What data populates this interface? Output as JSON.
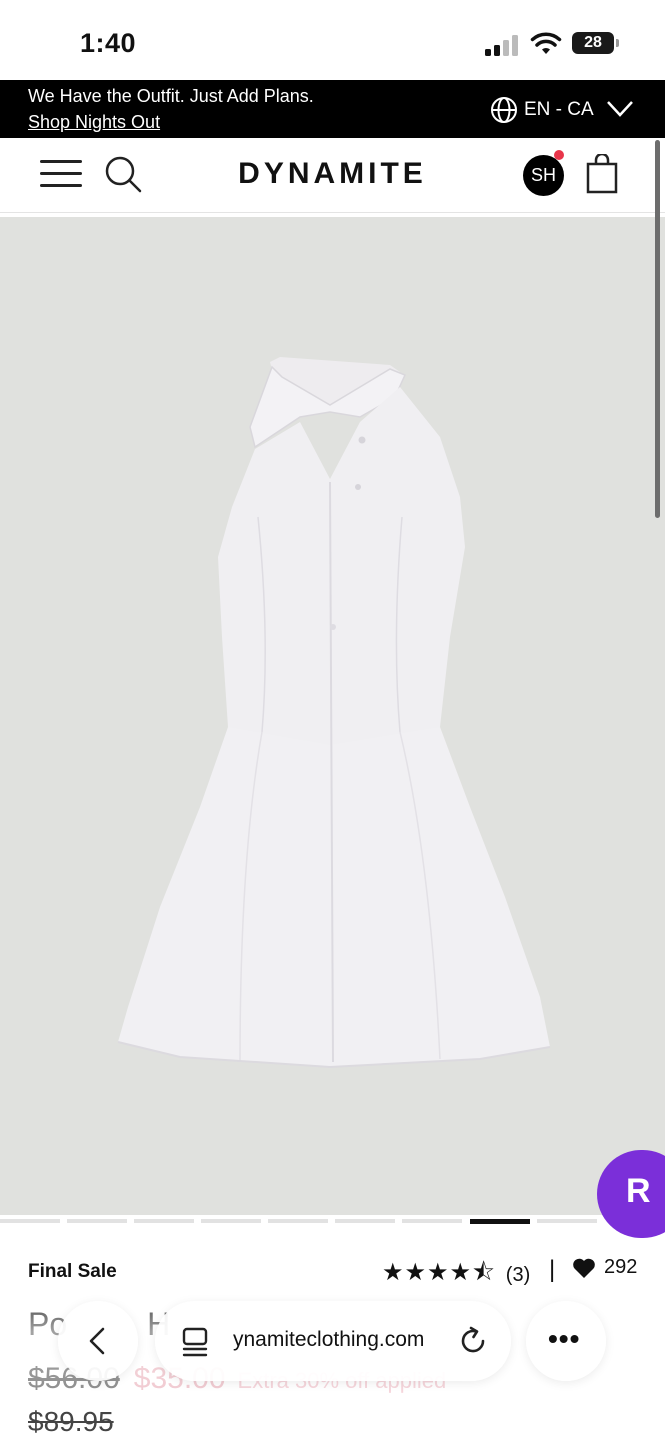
{
  "status_bar": {
    "time": "1:40",
    "battery": "28"
  },
  "promo": {
    "message": "We Have the Outfit. Just Add Plans.",
    "link": "Shop Nights Out",
    "language": "EN - CA"
  },
  "header": {
    "brand": "DYNAMITE",
    "account_initials": "SH"
  },
  "rakuten": {
    "label": "R",
    "color": "#7b2fd9"
  },
  "carousel": {
    "total": 9,
    "active": 8
  },
  "product": {
    "badge": "Final Sale",
    "rating": 4.5,
    "stars": "★★★★⯪",
    "review_count": "(3)",
    "separator": "|",
    "likes": "292",
    "title_partial": "Po",
    "title_partial_2": "H",
    "price_old": "$56.00",
    "price_sale": "$35.00",
    "discount_note": "Extra 30% off applied",
    "price_original": "$89.95"
  },
  "browser": {
    "url": "ynamiteclothing.com",
    "more": "•••"
  }
}
